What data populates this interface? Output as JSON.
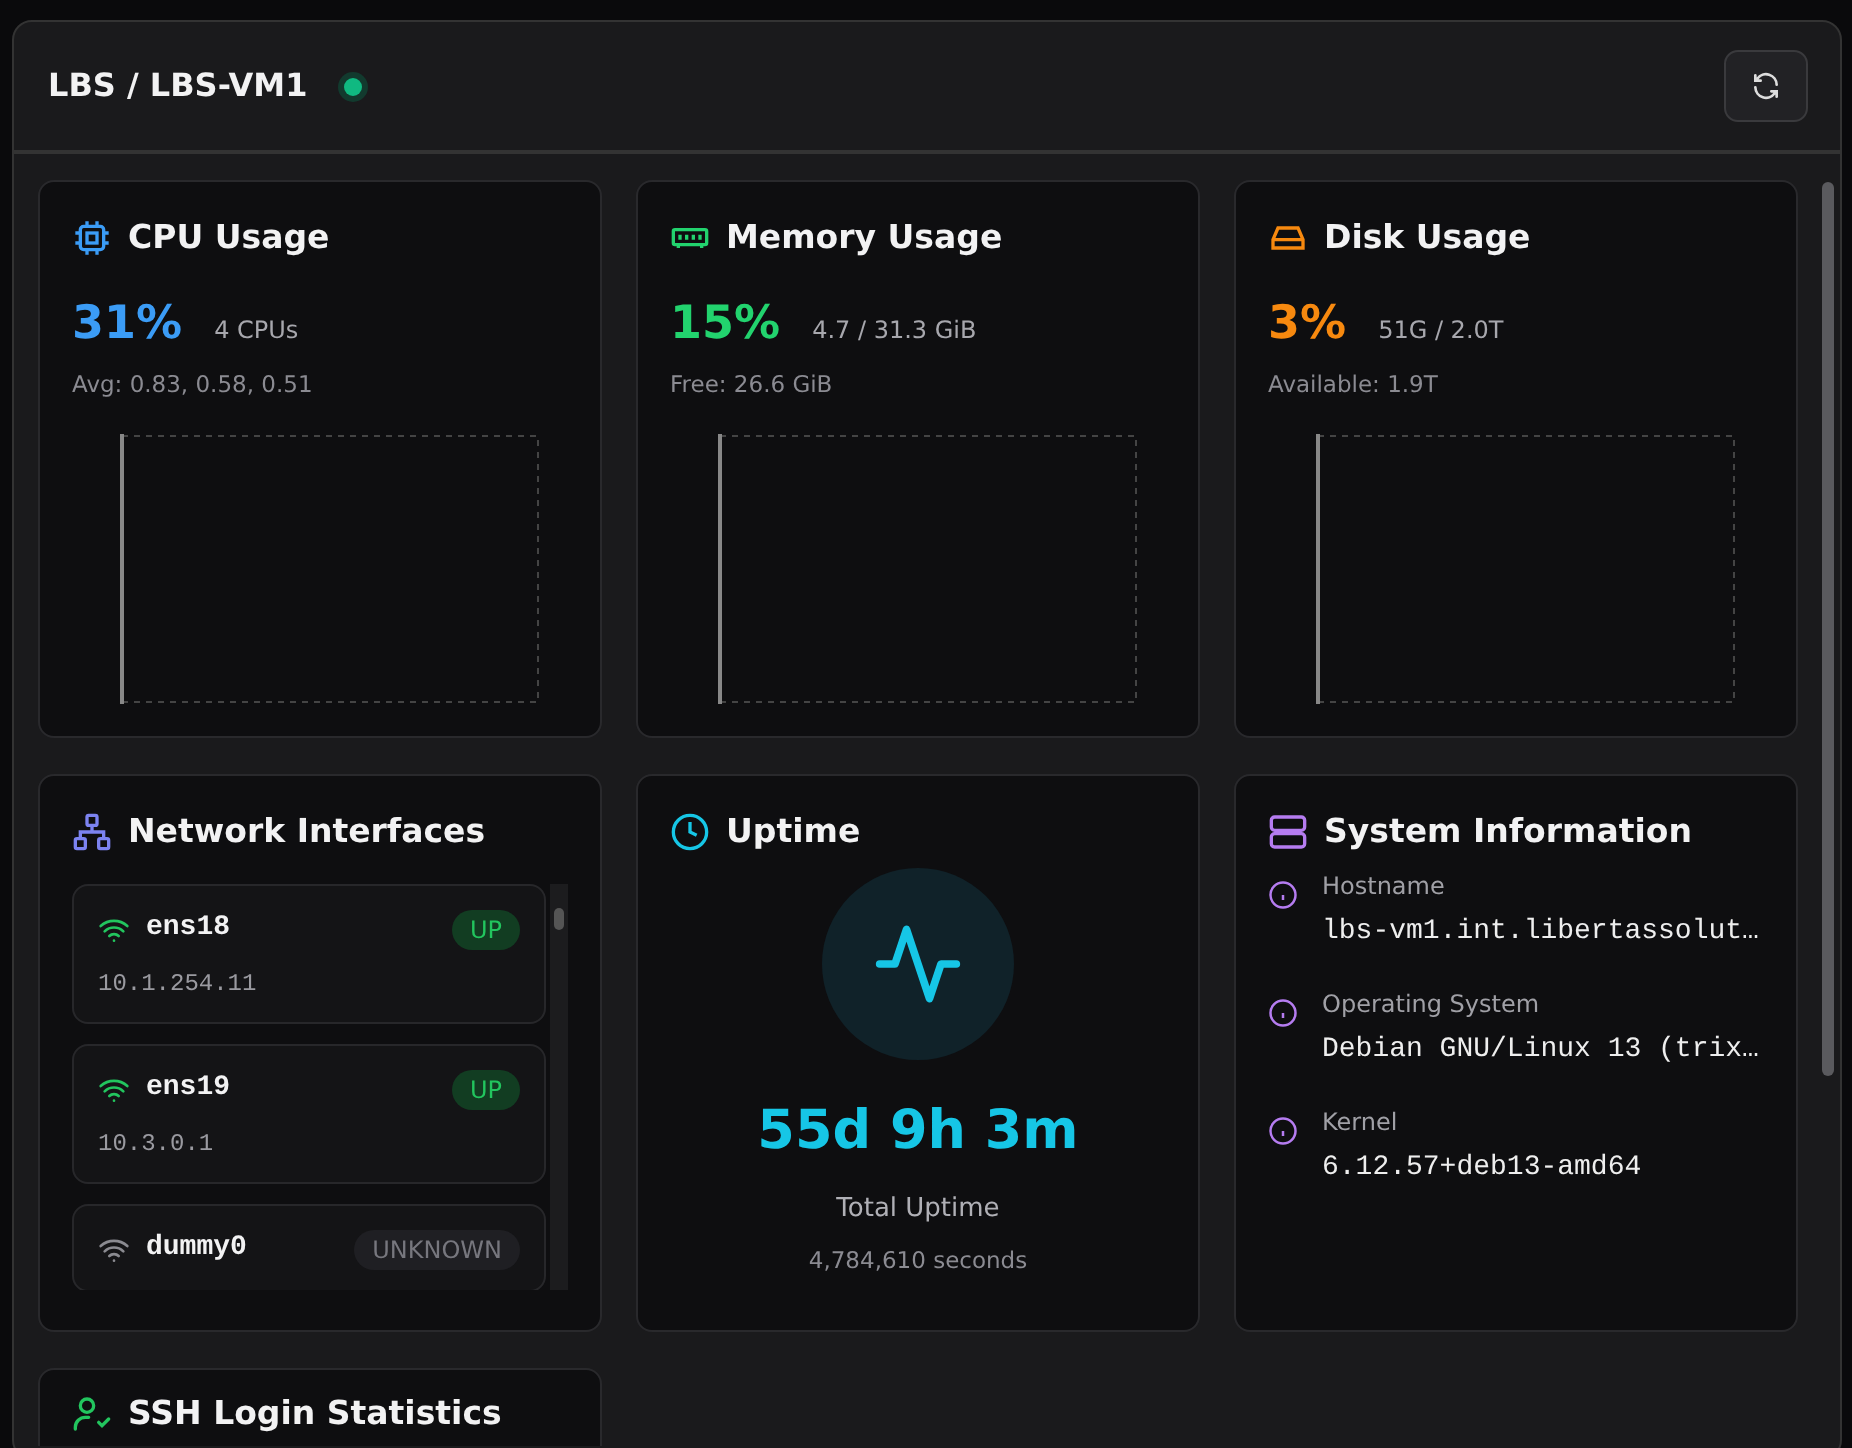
{
  "header": {
    "title": "LBS / LBS-VM1",
    "online": true
  },
  "metrics": [
    {
      "kind": "cpu",
      "title": "CPU Usage",
      "value": "31%",
      "detail": "4 CPUs",
      "sub": "Avg: 0.83, 0.58, 0.51",
      "color": "#3b9cf6"
    },
    {
      "kind": "memory",
      "title": "Memory Usage",
      "value": "15%",
      "detail": "4.7 / 31.3 GiB",
      "sub": "Free: 26.6 GiB",
      "color": "#22d36e"
    },
    {
      "kind": "disk",
      "title": "Disk Usage",
      "value": "3%",
      "detail": "51G / 2.0T",
      "sub": "Available: 1.9T",
      "color": "#f7890f"
    }
  ],
  "network": {
    "title": "Network Interfaces",
    "interfaces": [
      {
        "name": "ens18",
        "ip": "10.1.254.11",
        "state": "UP",
        "active": true
      },
      {
        "name": "ens19",
        "ip": "10.3.0.1",
        "state": "UP",
        "active": true
      },
      {
        "name": "dummy0",
        "state": "UNKNOWN",
        "active": false
      }
    ]
  },
  "uptime": {
    "title": "Uptime",
    "value": "55d 9h 3m",
    "label": "Total Uptime",
    "seconds": "4,784,610 seconds"
  },
  "system": {
    "title": "System Information",
    "items": [
      {
        "label": "Hostname",
        "value": "lbs-vm1.int.libertassolut…"
      },
      {
        "label": "Operating System",
        "value": "Debian GNU/Linux 13 (trix…"
      },
      {
        "label": "Kernel",
        "value": "6.12.57+deb13-amd64"
      }
    ]
  },
  "ssh": {
    "title": "SSH Login Statistics"
  }
}
